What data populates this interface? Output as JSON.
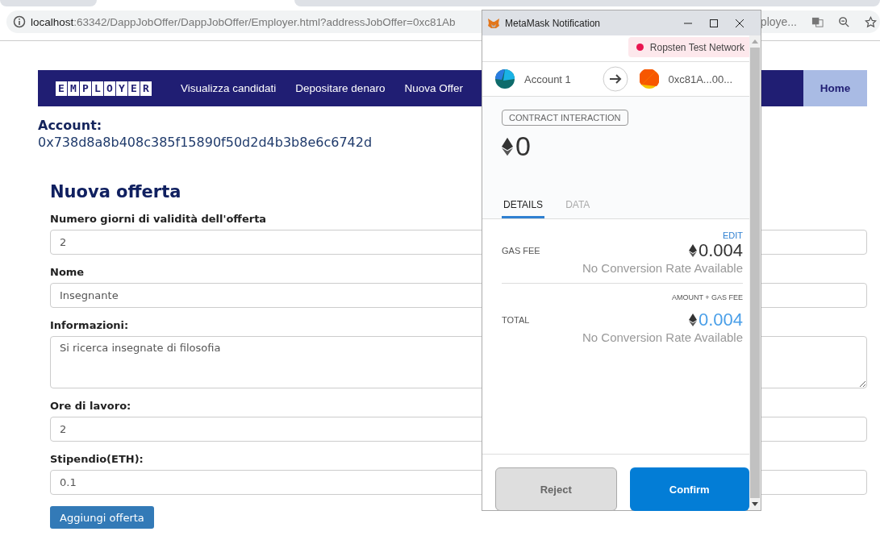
{
  "browser": {
    "url_host": "localhost",
    "url_rest": ":63342/DappJobOffer/DappJobOffer/Employer.html?addressJobOffer=0xc81Ab",
    "url_tail": "ploye..."
  },
  "nav": {
    "logo_letters": [
      "E",
      "M",
      "P",
      "L",
      "O",
      "Y",
      "E",
      "R"
    ],
    "links": [
      {
        "label": "Visualizza candidati",
        "selected": false
      },
      {
        "label": "Depositare denaro",
        "selected": false
      },
      {
        "label": "Nuova Offer",
        "selected": false
      },
      {
        "label": "Home",
        "selected": true
      }
    ]
  },
  "account": {
    "label": "Account:",
    "address": "0x738d8a8b408c385f15890f50d2d4b3b8e6c6742d"
  },
  "form": {
    "title": "Nuova offerta",
    "fields": [
      {
        "label": "Numero giorni di validità dell'offerta",
        "value": "2",
        "kind": "input"
      },
      {
        "label": "Nome",
        "value": "Insegnante",
        "kind": "input"
      },
      {
        "label": "Informazioni:",
        "value": "Si ricerca insegnate di filosofia",
        "kind": "textarea"
      },
      {
        "label": "Ore di lavoro:",
        "value": "2",
        "kind": "input"
      },
      {
        "label": "Stipendio(ETH):",
        "value": "0.1",
        "kind": "input"
      }
    ],
    "submit": "Aggiungi offerta"
  },
  "popup": {
    "title": "MetaMask Notification",
    "network": "Ropsten Test Network",
    "from": "Account 1",
    "to": "0xc81A...00...",
    "badge": "CONTRACT INTERACTION",
    "amount": "0",
    "tabs": [
      {
        "label": "DETAILS",
        "selected": true
      },
      {
        "label": "DATA",
        "selected": false
      }
    ],
    "edit": "EDIT",
    "gas_label": "GAS FEE",
    "gas_value": "0.004",
    "gas_conversion": "No Conversion Rate Available",
    "total_caption": "AMOUNT + GAS FEE",
    "total_label": "TOTAL",
    "total_value": "0.004",
    "total_conversion": "No Conversion Rate Available",
    "buttons": [
      {
        "label": "Reject",
        "kind": "secondary"
      },
      {
        "label": "Confirm",
        "kind": "primary"
      }
    ]
  }
}
